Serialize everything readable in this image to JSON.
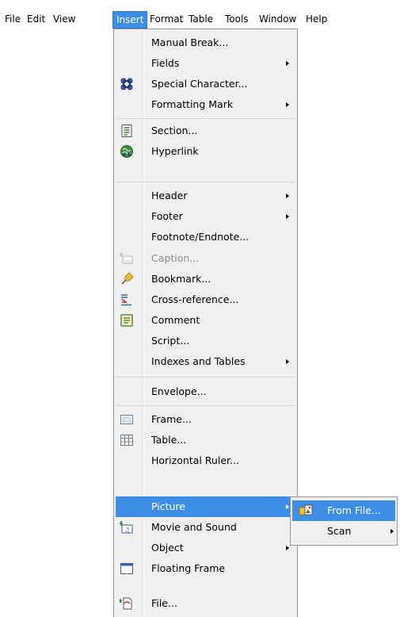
{
  "menubar": {
    "items": [
      "File",
      "Edit",
      "View",
      "Insert",
      "Format",
      "Table",
      "Tools",
      "Window",
      "Help"
    ],
    "active": "Insert"
  },
  "insert_menu": {
    "items": [
      {
        "label": "Manual Break...",
        "icon": null,
        "submenu": false
      },
      {
        "label": "Fields",
        "icon": null,
        "submenu": true
      },
      {
        "label": "Special Character...",
        "icon": "special-character-icon",
        "submenu": false
      },
      {
        "label": "Formatting Mark",
        "icon": null,
        "submenu": true
      },
      {
        "label": "Section...",
        "icon": "section-icon",
        "submenu": false
      },
      {
        "label": "Hyperlink",
        "icon": "hyperlink-icon",
        "submenu": false
      },
      {
        "label": "Header",
        "icon": null,
        "submenu": true
      },
      {
        "label": "Footer",
        "icon": null,
        "submenu": true
      },
      {
        "label": "Footnote/Endnote...",
        "icon": null,
        "submenu": false
      },
      {
        "label": "Caption...",
        "icon": "caption-icon",
        "submenu": false,
        "disabled": true
      },
      {
        "label": "Bookmark...",
        "icon": "bookmark-icon",
        "submenu": false
      },
      {
        "label": "Cross-reference...",
        "icon": "cross-reference-icon",
        "submenu": false
      },
      {
        "label": "Comment",
        "icon": "comment-icon",
        "submenu": false
      },
      {
        "label": "Script...",
        "icon": null,
        "submenu": false
      },
      {
        "label": "Indexes and Tables",
        "icon": null,
        "submenu": true
      },
      {
        "label": "Envelope...",
        "icon": null,
        "submenu": false
      },
      {
        "label": "Frame...",
        "icon": "frame-icon",
        "submenu": false
      },
      {
        "label": "Table...",
        "icon": "table-icon",
        "submenu": false
      },
      {
        "label": "Horizontal Ruler...",
        "icon": null,
        "submenu": false
      },
      {
        "label": "Picture",
        "icon": null,
        "submenu": true,
        "highlighted": true
      },
      {
        "label": "Movie and Sound",
        "icon": "movie-sound-icon",
        "submenu": false
      },
      {
        "label": "Object",
        "icon": null,
        "submenu": true
      },
      {
        "label": "Floating Frame",
        "icon": "floating-frame-icon",
        "submenu": false
      },
      {
        "label": "File...",
        "icon": "file-icon",
        "submenu": false
      }
    ]
  },
  "picture_submenu": {
    "items": [
      {
        "label": "From File...",
        "icon": "from-file-icon",
        "submenu": false,
        "highlighted": true
      },
      {
        "label": "Scan",
        "icon": null,
        "submenu": true
      }
    ]
  },
  "colors": {
    "highlight": "#3d8ee6",
    "menu_background": "#f0f0f0",
    "menu_border": "#979797",
    "disabled_text": "#8b8b8b"
  }
}
